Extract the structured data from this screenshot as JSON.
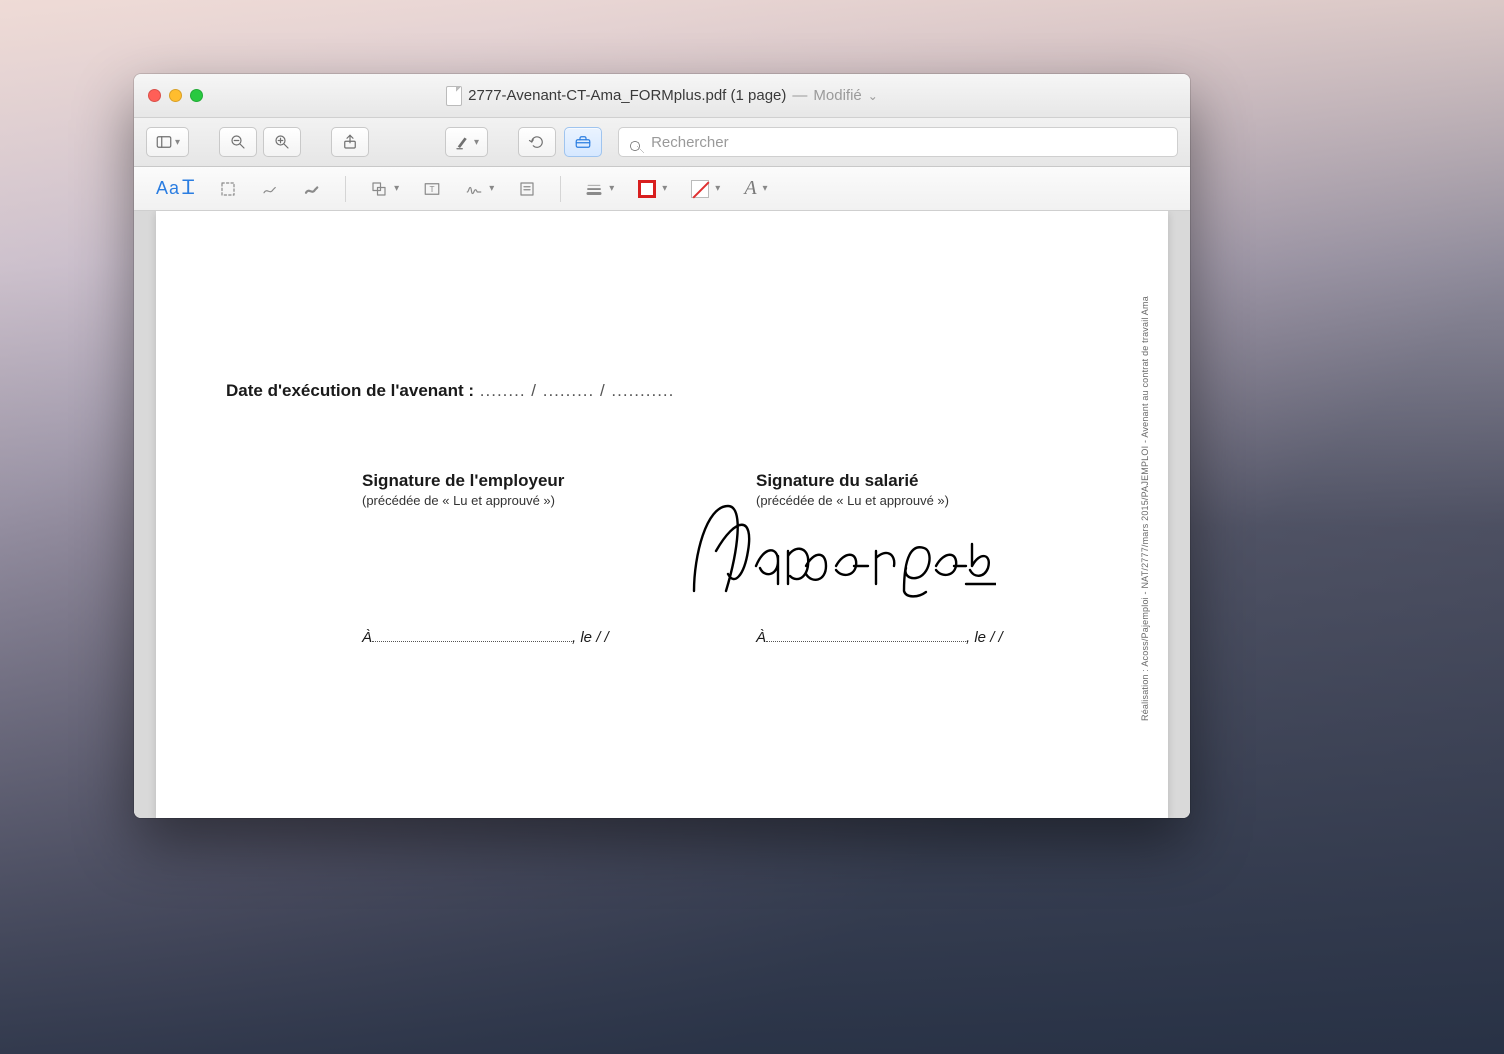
{
  "window": {
    "title_main": "2777-Avenant-CT-Ama_FORMplus.pdf (1 page)",
    "title_separator": " — ",
    "title_modified": "Modifié"
  },
  "toolbar": {
    "search_placeholder": "Rechercher"
  },
  "markup": {
    "text_tool_label": "Aa"
  },
  "document": {
    "date_label": "Date d'exécution de l'avenant :",
    "date_dots": " ........ / ......... / ...........",
    "employer_title": "Signature de l'employeur",
    "employer_sub": "(précédée de « Lu et approuvé »)",
    "employee_title": "Signature du salarié",
    "employee_sub": "(précédée de « Lu et approuvé »)",
    "place_prefix": "À",
    "place_le": ", le",
    "place_slashes": "      /     /",
    "side_credit": "Réalisation : Acoss/Pajemploi - NAT/2777/mars 2015/PAJEMPLOI - Avenant au contrat de travail Ama",
    "signature_text": "Papergeek"
  },
  "colors": {
    "accent": "#2a7de1",
    "border_swatch": "#d81f1f"
  }
}
